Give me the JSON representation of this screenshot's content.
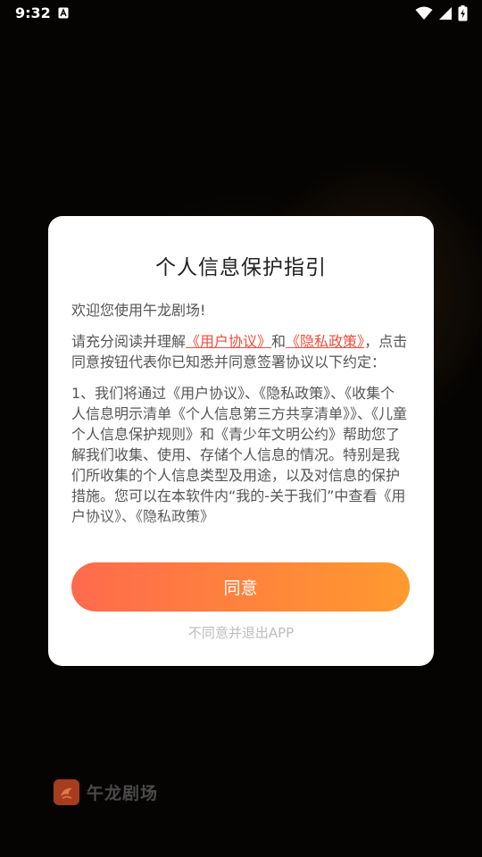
{
  "status_bar": {
    "time": "9:32"
  },
  "dialog": {
    "title": "个人信息保护指引",
    "welcome": "欢迎您使用午龙剧场!",
    "para1_prefix": "请充分阅读并理解",
    "link_user_agreement": "《用户协议》",
    "para1_mid": "和",
    "link_privacy_policy": "《隐私政策》",
    "para1_suffix": "，点击同意按钮代表你已知悉并同意签署协议以下约定：",
    "para2": "1、我们将通过《用户协议》、《隐私政策》、《收集个人信息明示清单《个人信息第三方共享清单》》、《儿童个人信息保护规则》和《青少年文明公约》帮助您了解我们收集、使用、存储个人信息的情况。特别是我们所收集的个人信息类型及用途，以及对信息的保护措施。您可以在本软件内“我的-关于我们”中查看《用户协议》、《隐私政策》",
    "agree_label": "同意",
    "disagree_label": "不同意并退出APP"
  },
  "brand": {
    "name": "午龙剧场"
  },
  "colors": {
    "accent_link": "#f04c3c",
    "button_start": "#ff6a4c",
    "button_end": "#ff9a2e"
  }
}
